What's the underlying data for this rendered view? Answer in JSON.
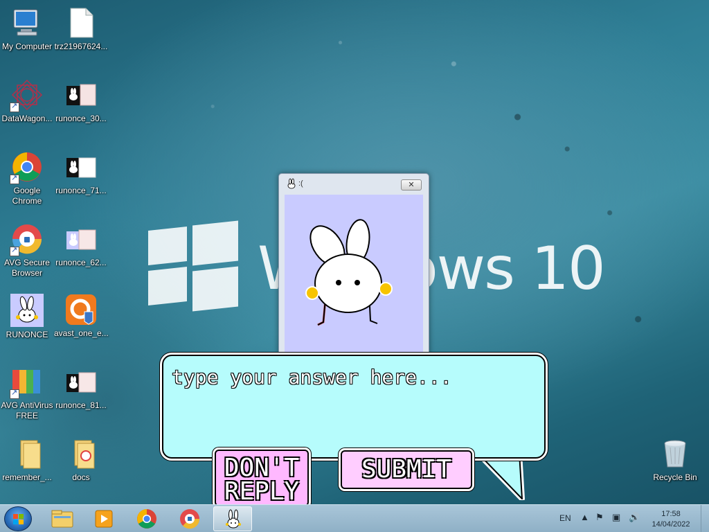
{
  "wallpaper": {
    "brand_text": "Windows 10"
  },
  "desktop_icons": [
    {
      "label": "My Computer",
      "icon": "computer-icon"
    },
    {
      "label": "trz21967624...",
      "icon": "file-icon"
    },
    {
      "label": "DataWagon...",
      "icon": "datawagon-icon"
    },
    {
      "label": "runonce_30...",
      "icon": "image-file-icon"
    },
    {
      "label": "Google Chrome",
      "icon": "chrome-icon"
    },
    {
      "label": "runonce_71...",
      "icon": "image-file-icon"
    },
    {
      "label": "AVG Secure Browser",
      "icon": "avg-browser-icon"
    },
    {
      "label": "runonce_62...",
      "icon": "image-file-icon"
    },
    {
      "label": "RUNONCE",
      "icon": "bunny-icon"
    },
    {
      "label": "avast_one_e...",
      "icon": "avast-icon"
    },
    {
      "label": "AVG AntiVirus FREE",
      "icon": "avg-antivirus-icon"
    },
    {
      "label": "runonce_81...",
      "icon": "image-file-icon"
    },
    {
      "label": "remember_...",
      "icon": "folder-icon"
    },
    {
      "label": "docs",
      "icon": "folder-icon"
    },
    {
      "label": "Recycle Bin",
      "icon": "recycle-bin-icon"
    }
  ],
  "runonce_window": {
    "title": ":(",
    "close_label": "✕"
  },
  "dialog": {
    "placeholder": "type your answer here...",
    "dont_reply_label": "DON'T\nREPLY",
    "submit_label": "SUBMIT"
  },
  "taskbar": {
    "pinned": [
      "windows-explorer-icon",
      "media-player-icon",
      "chrome-icon",
      "avg-browser-icon",
      "bunny-icon"
    ],
    "language": "EN",
    "time": "17:58",
    "date": "14/04/2022"
  }
}
